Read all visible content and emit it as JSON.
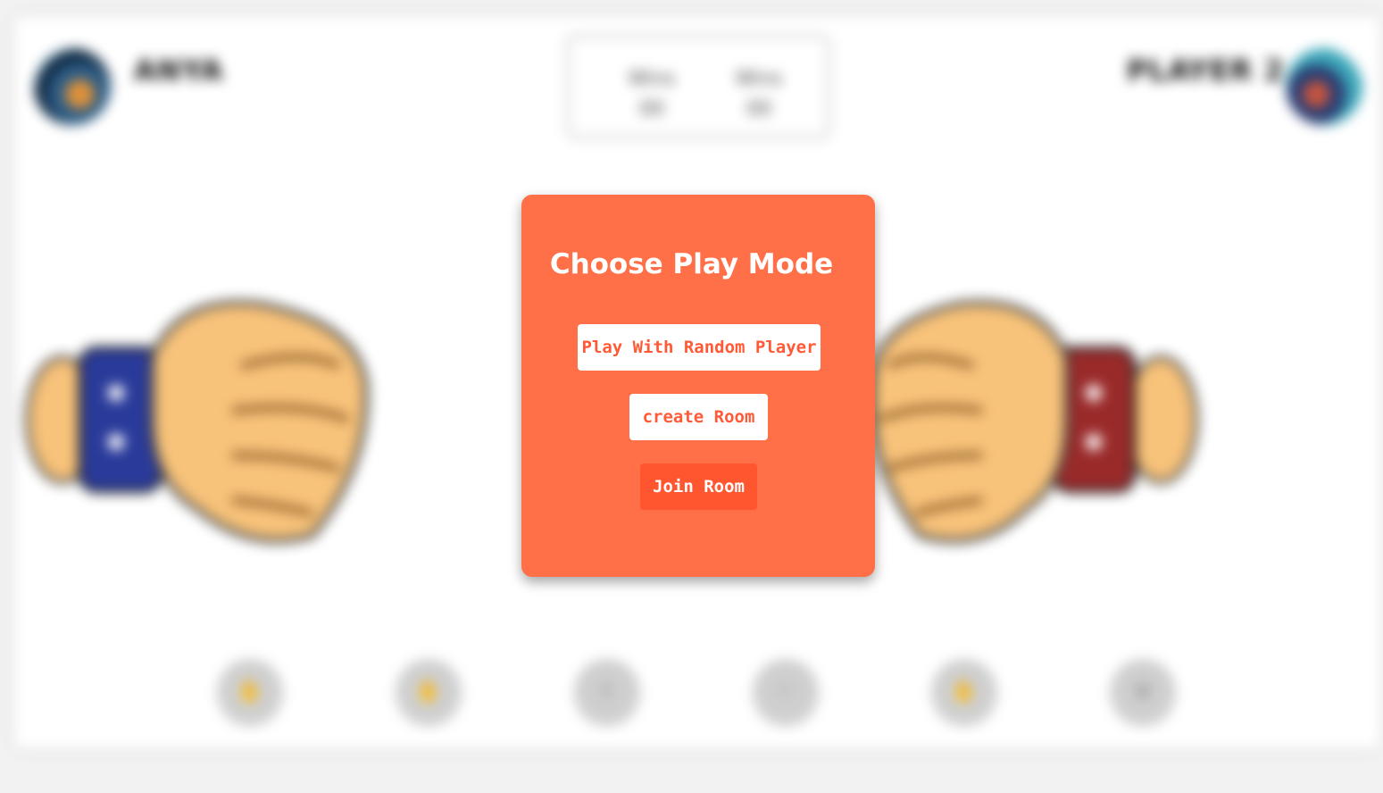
{
  "header": {
    "left_player_name": "ANYA",
    "right_player_name": "PLAYER 2",
    "score": [
      {
        "label": "Wins",
        "value": "00"
      },
      {
        "label": "Wins",
        "value": "00"
      }
    ]
  },
  "controls": [
    {
      "icon": "rock-icon"
    },
    {
      "icon": "paper-icon"
    },
    {
      "icon": "scissors-icon"
    },
    {
      "icon": "lizard-icon"
    },
    {
      "icon": "spock-icon"
    },
    {
      "icon": "settings-icon"
    }
  ],
  "modal": {
    "title": "Choose Play Mode",
    "buttons": {
      "random_player": "Play With Random Player",
      "create_room": "create Room",
      "join_room": "Join Room"
    }
  },
  "colors": {
    "modal_background": "#ff7049",
    "primary_button_text": "#ff5a35",
    "join_button_background": "#ff5630",
    "left_wristband": "#2a3a9a",
    "right_wristband": "#9a2a2a",
    "skin": "#f7c27a"
  }
}
